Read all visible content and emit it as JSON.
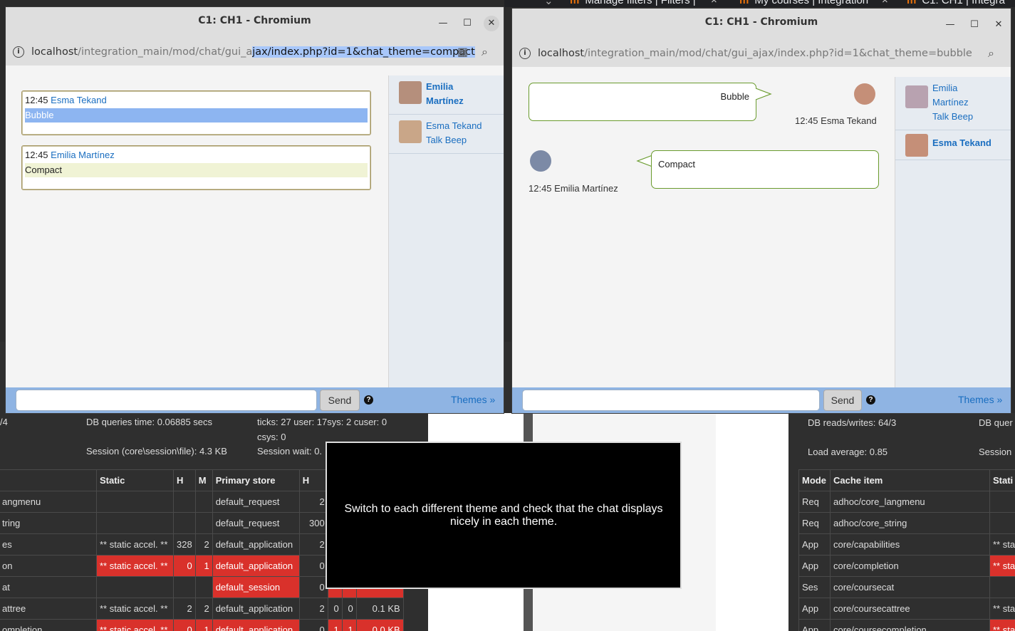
{
  "background": {
    "tabs": [
      "Manage filters | Filters |",
      "My courses | Integration",
      "C1: CH1 | Integra"
    ],
    "left_stats": {
      "row1_left": "/4",
      "db_queries_time": "DB queries time: 0.06885 secs",
      "ticks": "ticks: 27 user: 17sys: 2 cuser: 0",
      "csys": "csys: 0",
      "session": "Session (core\\session\\file): 4.3 KB",
      "session_wait": "Session wait: 0."
    },
    "left_table": {
      "headers": [
        "",
        "Static",
        "H",
        "M",
        "Primary store",
        "H",
        "",
        "",
        ""
      ],
      "rows": [
        {
          "name": "angmenu",
          "static": "",
          "h": "",
          "m": "",
          "store": "default_request",
          "h2": "2",
          "c1": "",
          "c2": "",
          "size": "",
          "red": false
        },
        {
          "name": "tring",
          "static": "",
          "h": "",
          "m": "",
          "store": "default_request",
          "h2": "300",
          "c1": "",
          "c2": "",
          "size": "",
          "red": false
        },
        {
          "name": "es",
          "static": "** static accel. **",
          "h": "328",
          "m": "2",
          "store": "default_application",
          "h2": "2",
          "c1": "",
          "c2": "",
          "size": "",
          "red": false
        },
        {
          "name": "on",
          "static": "** static accel. **",
          "h": "0",
          "m": "1",
          "store": "default_application",
          "h2": "0",
          "c1": "",
          "c2": "",
          "size": "",
          "red": true
        },
        {
          "name": "at",
          "static": "",
          "h": "",
          "m": "",
          "store": "default_session",
          "h2": "0",
          "c1": "",
          "c2": "",
          "size": "",
          "red": "store"
        },
        {
          "name": "attree",
          "static": "** static accel. **",
          "h": "2",
          "m": "2",
          "store": "default_application",
          "h2": "2",
          "c1": "0",
          "c2": "0",
          "size": "0.1 KB",
          "red": false
        },
        {
          "name": "ompletion",
          "static": "** static accel. **",
          "h": "0",
          "m": "1",
          "store": "default_application",
          "h2": "0",
          "c1": "1",
          "c2": "1",
          "size": "0.0 KB",
          "red": true
        }
      ]
    },
    "right_stats": {
      "db_rw": "DB reads/writes: 64/3",
      "db_quer": "DB quer",
      "load_avg": "Load average: 0.85",
      "session": "Session"
    },
    "right_table": {
      "headers": [
        "Mode",
        "Cache item",
        "Stati"
      ],
      "rows": [
        {
          "mode": "Req",
          "item": "adhoc/core_langmenu",
          "static": "",
          "red": false
        },
        {
          "mode": "Req",
          "item": "adhoc/core_string",
          "static": "",
          "red": false
        },
        {
          "mode": "App",
          "item": "core/capabilities",
          "static": "** sta",
          "red": false
        },
        {
          "mode": "App",
          "item": "core/completion",
          "static": "** stat",
          "red": true
        },
        {
          "mode": "Ses",
          "item": "core/coursecat",
          "static": "",
          "red": false
        },
        {
          "mode": "App",
          "item": "core/coursecattree",
          "static": "** sta",
          "red": false
        },
        {
          "mode": "App",
          "item": "core/coursecompletion",
          "static": "** sta",
          "red": true
        }
      ]
    }
  },
  "left_window": {
    "title": "C1: CH1 - Chromium",
    "url_host": "localhost",
    "url_path_pre": "/integration_main/mod/chat/gui_a",
    "url_path_sel": "jax/index.php?id=1&chat_theme=compact",
    "theme": "compact",
    "messages": [
      {
        "time": "12:45",
        "user": "Esma Tekand",
        "text": "Bubble"
      },
      {
        "time": "12:45",
        "user": "Emilia Martínez",
        "text": "Compact"
      }
    ],
    "users": [
      {
        "line1": "Emilia",
        "line2": "Martínez",
        "line3": ""
      },
      {
        "line1": "Esma Tekand",
        "line2": "Talk Beep",
        "line3": ""
      }
    ],
    "send_label": "Send",
    "help_label": "?",
    "themes_label": "Themes »"
  },
  "right_window": {
    "title": "C1: CH1 - Chromium",
    "url_host": "localhost",
    "url_path": "/integration_main/mod/chat/gui_ajax/index.php?id=1&chat_theme=bubble",
    "theme": "bubble",
    "messages": [
      {
        "time": "12:45",
        "user": "Esma Tekand",
        "text": "Bubble",
        "side": "right"
      },
      {
        "time": "12:45",
        "user": "Emilia Martínez",
        "text": "Compact",
        "side": "left"
      }
    ],
    "users": [
      {
        "line1": "Emilia",
        "line2": "Martínez",
        "line3": "Talk Beep"
      },
      {
        "line1": "Esma Tekand",
        "line2": "",
        "line3": ""
      }
    ],
    "send_label": "Send",
    "help_label": "?",
    "themes_label": "Themes »"
  },
  "overlay_text": "Switch to each different theme and check that the chat displays nicely in each theme.",
  "colors": {
    "accent_link": "#1a6ec0",
    "input_bar": "#8fb4e3",
    "bubble_border": "#6a9b2e",
    "debug_red": "#d9312b"
  }
}
